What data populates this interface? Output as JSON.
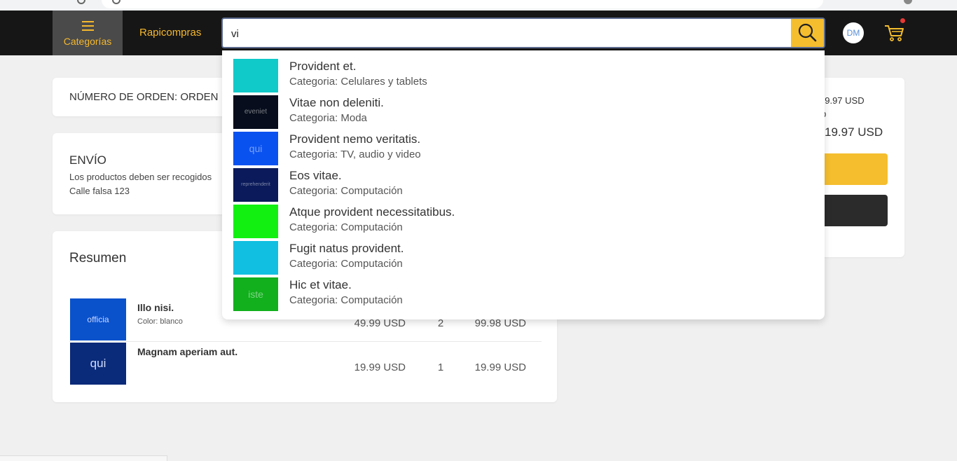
{
  "navbar": {
    "categories_label": "Categorías",
    "rapicompras_label": "Rapicompras",
    "search_value": "vi",
    "avatar_initials": "DM"
  },
  "order": {
    "number_label": "NÚMERO DE ORDEN: ORDEN"
  },
  "shipping": {
    "title": "ENVÍO",
    "line1": "Los productos deben ser recogidos",
    "address": "Calle falsa 123"
  },
  "summary": {
    "title": "Resumen",
    "items": [
      {
        "name": "Illo nisi.",
        "color": "Color: blanco",
        "thumb_text": "officia",
        "thumb_color": "#0a52cc",
        "price": "49.99 USD",
        "qty": "2",
        "total": "99.98 USD"
      },
      {
        "name": "Magnam aperiam aut.",
        "color": "",
        "thumb_text": "qui",
        "thumb_color": "#0a2a7a",
        "price": "19.99 USD",
        "qty": "1",
        "total": "19.99 USD"
      }
    ]
  },
  "right_summary": {
    "subtotal": "19.97 USD",
    "line2": "D",
    "total": "19.97 USD"
  },
  "suggestions": [
    {
      "name": "Provident et.",
      "category": "Categoria: Celulares y tablets",
      "thumb_color": "#10c9c9",
      "thumb_text": ""
    },
    {
      "name": "Vitae non deleniti.",
      "category": "Categoria: Moda",
      "thumb_color": "#070d1c",
      "thumb_text": "eveniet"
    },
    {
      "name": "Provident nemo veritatis.",
      "category": "Categoria: TV, audio y video",
      "thumb_color": "#0a52f0",
      "thumb_text": "qui"
    },
    {
      "name": "Eos vitae.",
      "category": "Categoria: Computación",
      "thumb_color": "#0a1a5a",
      "thumb_text": "reprehenderit"
    },
    {
      "name": "Atque provident necessitatibus.",
      "category": "Categoria: Computación",
      "thumb_color": "#11f011",
      "thumb_text": ""
    },
    {
      "name": "Fugit natus provident.",
      "category": "Categoria: Computación",
      "thumb_color": "#11bfe0",
      "thumb_text": ""
    },
    {
      "name": "Hic et vitae.",
      "category": "Categoria: Computación",
      "thumb_color": "#11b01c",
      "thumb_text": "iste"
    }
  ],
  "colors": {
    "accent": "#f5be2e",
    "navbar_bg": "#161616"
  }
}
